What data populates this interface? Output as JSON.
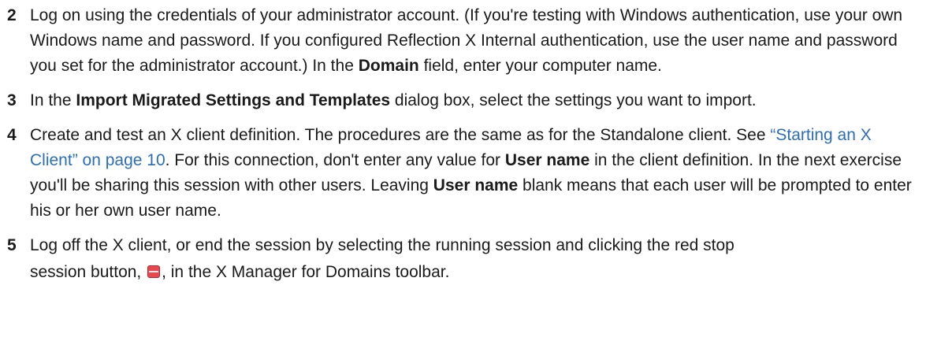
{
  "steps": [
    {
      "number": "2",
      "text_1": "Log on using the credentials of your administrator account. (If you're testing with Windows authentication, use your own Windows name and password. If you configured Reflection X Internal authentication, use the user name and password you set for the administrator account.) In the ",
      "bold_1": "Domain",
      "text_2": " field, enter your computer name."
    },
    {
      "number": "3",
      "text_1": "In the ",
      "bold_1": "Import Migrated Settings and Templates",
      "text_2": " dialog box, select the settings you want to import."
    },
    {
      "number": "4",
      "text_1": "Create and test an X client definition. The procedures are the same as for the Standalone client. See ",
      "link": "“Starting an X Client” on page 10",
      "text_2": ". For this connection, don't enter any value for ",
      "bold_1": "User name",
      "text_3": " in the client definition. In the next exercise you'll be sharing this session with other users. Leaving ",
      "bold_2": "User name",
      "text_4": " blank means that each user will be prompted to enter his or her own user name."
    },
    {
      "number": "5",
      "text_1": "Log off the X client, or end the session by selecting the running session and clicking the red stop",
      "text_2": "session button, ",
      "icon": "stop-session-icon",
      "text_3": ", in the X Manager for Domains toolbar."
    }
  ],
  "colors": {
    "link": "#2a6ebb",
    "stop_icon": "#e8474f"
  }
}
